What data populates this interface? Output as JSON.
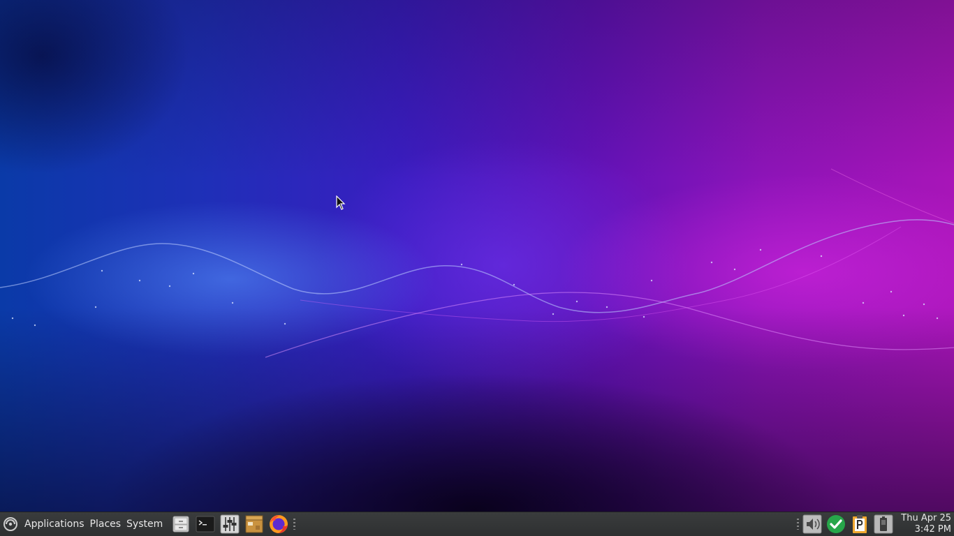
{
  "desktop": {
    "colors": {
      "left": "#0a3aa8",
      "center": "#3a1dc0",
      "right": "#a815b8"
    }
  },
  "panel": {
    "background": "#333536",
    "menus": {
      "applications": "Applications",
      "places": "Places",
      "system": "System"
    },
    "launchers": [
      {
        "name": "file-cabinet-icon"
      },
      {
        "name": "terminal-icon"
      },
      {
        "name": "mixer-sliders-icon"
      },
      {
        "name": "archive-box-icon"
      },
      {
        "name": "firefox-icon"
      }
    ],
    "tray": [
      {
        "name": "volume-icon"
      },
      {
        "name": "update-check-icon"
      },
      {
        "name": "clipboard-p-icon"
      },
      {
        "name": "power-manager-icon"
      }
    ],
    "clock": {
      "date": "Thu Apr 25",
      "time": "3:42 PM"
    }
  }
}
